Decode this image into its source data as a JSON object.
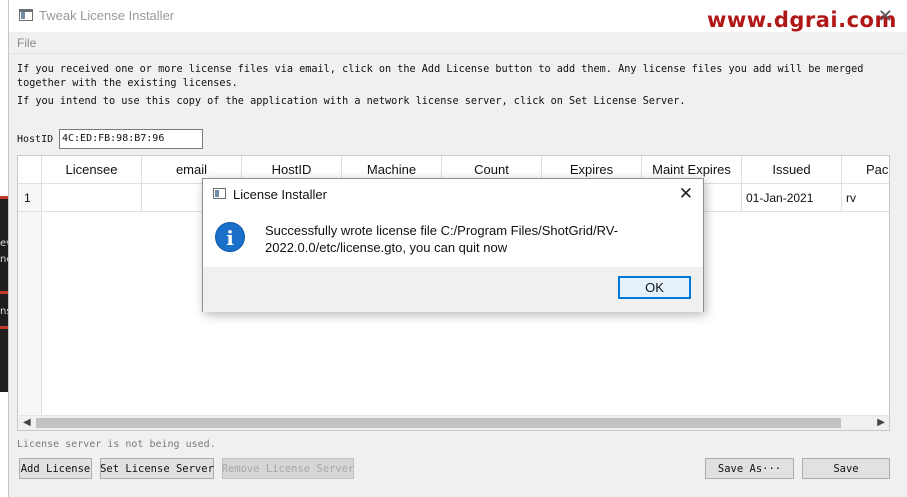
{
  "window": {
    "title": "Tweak License Installer",
    "close_glyph": "✕",
    "watermark": "www.dgrai.com"
  },
  "menu": {
    "file": "File"
  },
  "info": {
    "line1": "If you received one or more license files via email, click on the Add License button to add them. Any license files you add will be merged",
    "line2": "together with the existing licenses.",
    "line3": "If you intend to use this copy of the application with a network license server, click on Set License Server."
  },
  "hostid": {
    "label": "HostID",
    "value": "4C:ED:FB:98:B7:96"
  },
  "table": {
    "columns": [
      "",
      "Licensee",
      "email",
      "HostID",
      "Machine",
      "Count",
      "Expires",
      "Maint Expires",
      "Issued",
      "Packa"
    ],
    "rows": [
      [
        "1",
        "",
        "",
        "",
        "",
        "",
        "",
        "",
        "01-Jan-2021",
        "rv"
      ]
    ]
  },
  "status": "License server is not being used.",
  "buttons": {
    "add_license": "Add License",
    "set_license_server": "Set License Server",
    "remove_license_server": "Remove License Server",
    "save_as": "Save As···",
    "save": "Save"
  },
  "dialog": {
    "title": "License Installer",
    "close_glyph": "✕",
    "icon_glyph": "i",
    "message": "Successfully wrote license file C:/Program Files/ShotGrid/RV-2022.0.0/etc/license.gto, you can quit now",
    "ok": "OK"
  },
  "background": {
    "snippets": [
      "ev",
      "ne",
      "ns"
    ]
  },
  "colors": {
    "info_icon": "#1a6fc9",
    "watermark": "#b01818",
    "ok_border": "#0078d7"
  }
}
